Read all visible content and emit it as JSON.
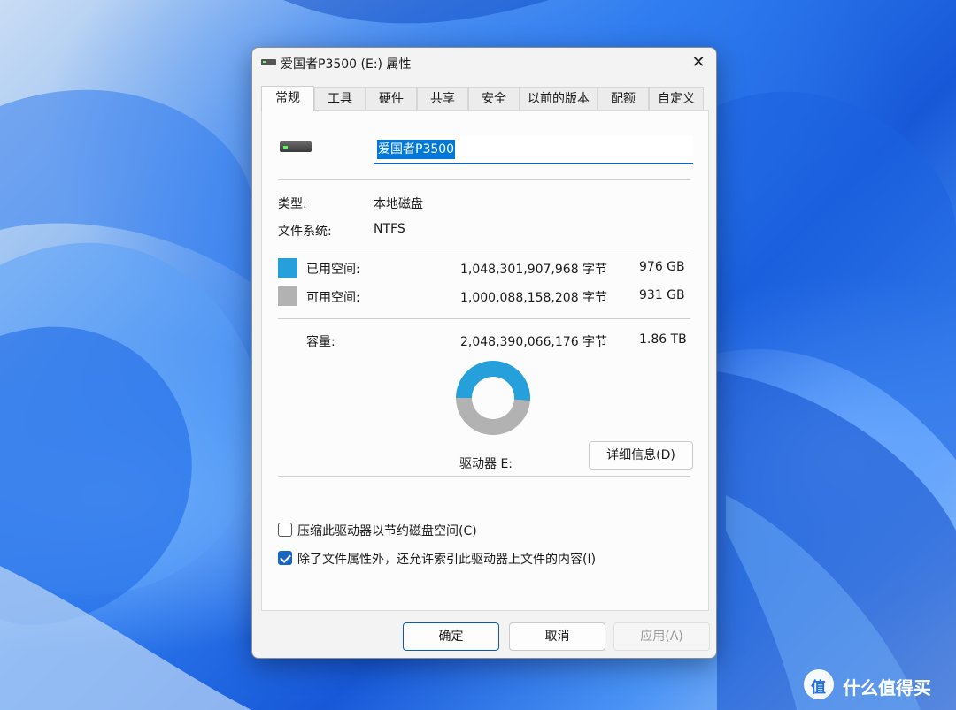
{
  "window": {
    "title": "爱国者P3500 (E:) 属性",
    "close": "✕"
  },
  "tabs": [
    {
      "label": "常规",
      "active": true
    },
    {
      "label": "工具"
    },
    {
      "label": "硬件"
    },
    {
      "label": "共享"
    },
    {
      "label": "安全"
    },
    {
      "label": "以前的版本"
    },
    {
      "label": "配额"
    },
    {
      "label": "自定义"
    }
  ],
  "general": {
    "volume_name": "爱国者P3500",
    "type_label": "类型:",
    "type_value": "本地磁盘",
    "fs_label": "文件系统:",
    "fs_value": "NTFS",
    "used": {
      "label": "已用空间:",
      "bytes": "1,048,301,907,968 字节",
      "size": "976 GB",
      "color": "#26a0da"
    },
    "free": {
      "label": "可用空间:",
      "bytes": "1,000,088,158,208 字节",
      "size": "931 GB",
      "color": "#b2b2b2"
    },
    "capacity": {
      "label": "容量:",
      "bytes": "2,048,390,066,176 字节",
      "size": "1.86 TB"
    },
    "used_fraction": 0.512,
    "drive_label": "驱动器 E:",
    "details_button": "详细信息(D)",
    "compress_checkbox": {
      "label": "压缩此驱动器以节约磁盘空间(C)",
      "checked": false
    },
    "index_checkbox": {
      "label": "除了文件属性外，还允许索引此驱动器上文件的内容(I)",
      "checked": true
    }
  },
  "buttons": {
    "ok": "确定",
    "cancel": "取消",
    "apply": "应用(A)"
  },
  "watermark": {
    "text": "什么值得买"
  }
}
